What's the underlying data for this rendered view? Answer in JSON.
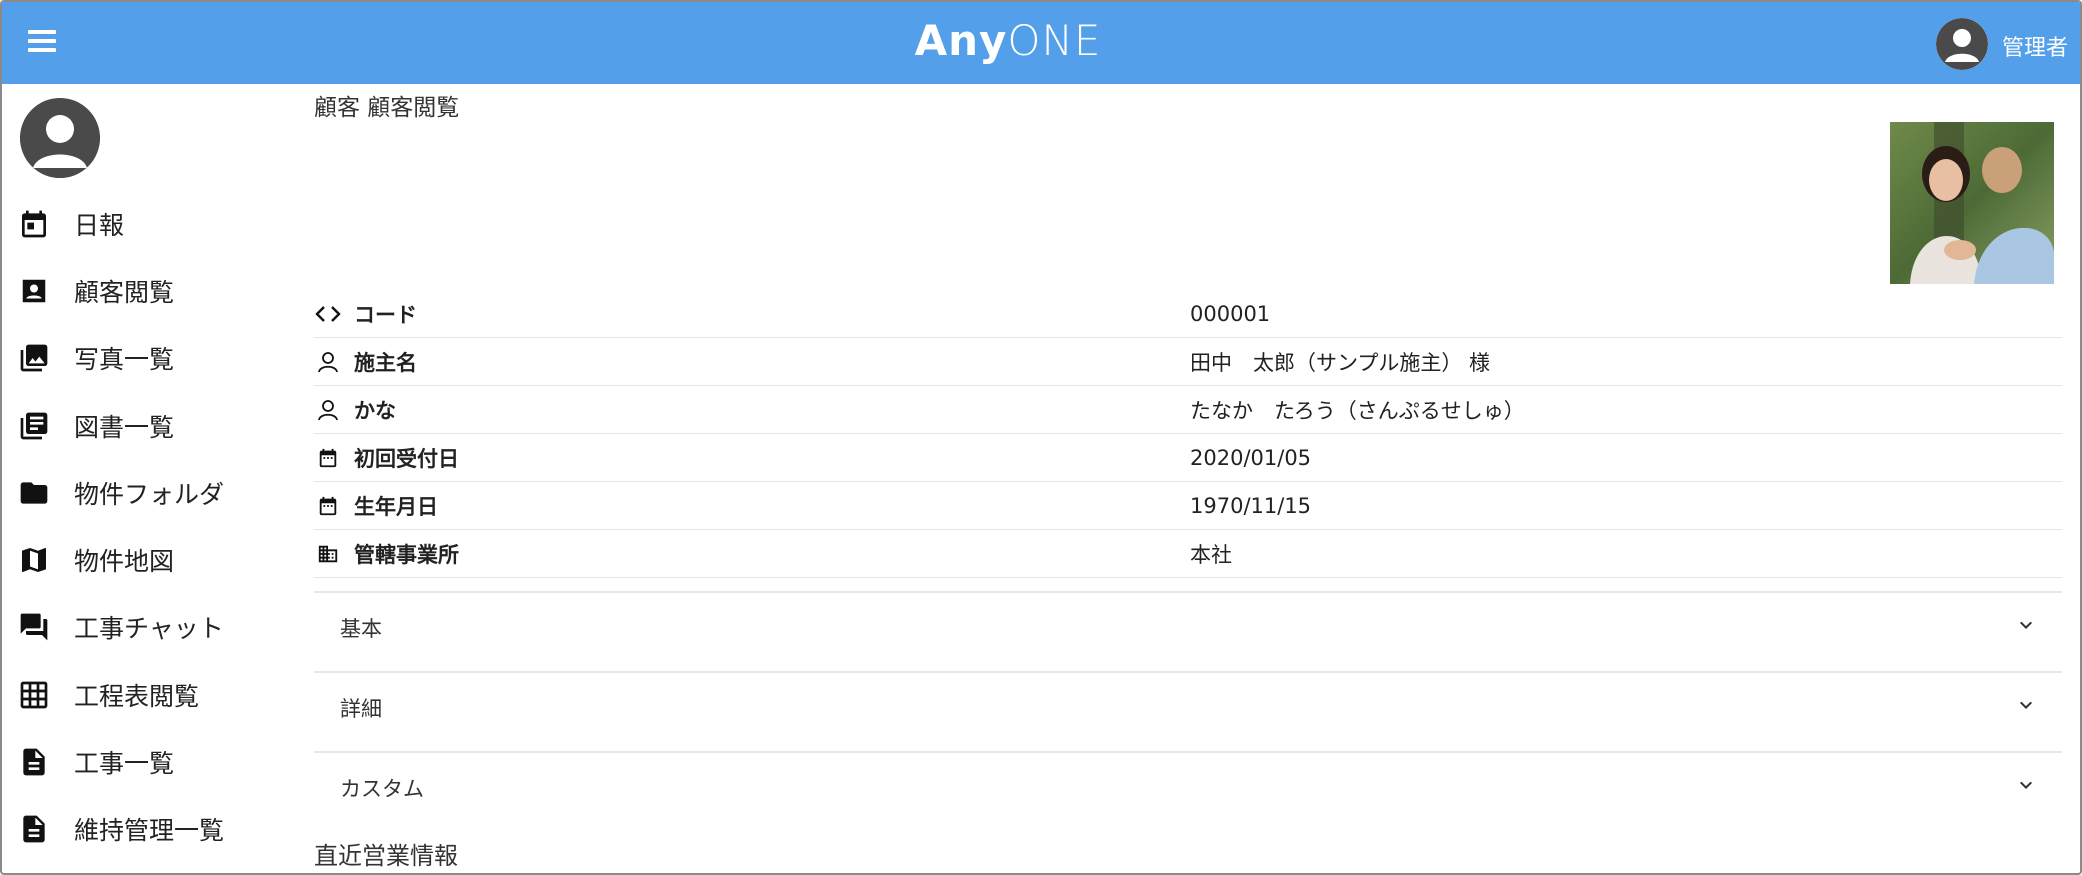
{
  "header": {
    "logo_bold": "Any",
    "logo_light": "ONE",
    "user_name": "管理者"
  },
  "sidebar": {
    "items": [
      {
        "label": "日報",
        "icon": "calendar-icon"
      },
      {
        "label": "顧客閲覧",
        "icon": "contact-card-icon"
      },
      {
        "label": "写真一覧",
        "icon": "photo-library-icon"
      },
      {
        "label": "図書一覧",
        "icon": "library-books-icon"
      },
      {
        "label": "物件フォルダ",
        "icon": "folder-icon"
      },
      {
        "label": "物件地図",
        "icon": "map-icon"
      },
      {
        "label": "工事チャット",
        "icon": "chat-icon"
      },
      {
        "label": "工程表閲覧",
        "icon": "grid-icon"
      },
      {
        "label": "工事一覧",
        "icon": "document-icon"
      },
      {
        "label": "維持管理一覧",
        "icon": "document-icon"
      }
    ]
  },
  "main": {
    "title": "顧客 顧客閲覧",
    "fields": [
      {
        "label": "コード",
        "value": "000001",
        "icon": "code-icon"
      },
      {
        "label": "施主名",
        "value": "田中　太郎（サンプル施主） 様",
        "icon": "person-icon"
      },
      {
        "label": "かな",
        "value": "たなか　たろう（さんぷるせしゅ）",
        "icon": "person-icon"
      },
      {
        "label": "初回受付日",
        "value": "2020/01/05",
        "icon": "calendar-icon"
      },
      {
        "label": "生年月日",
        "value": "1970/11/15",
        "icon": "calendar-icon"
      },
      {
        "label": "管轄事業所",
        "value": "本社",
        "icon": "building-icon"
      }
    ],
    "accordions": [
      {
        "label": "基本"
      },
      {
        "label": "詳細"
      },
      {
        "label": "カスタム"
      }
    ],
    "section_title": "直近営業情報"
  },
  "colors": {
    "header_bg": "#539fea",
    "avatar_bg": "#4a4a4a"
  }
}
